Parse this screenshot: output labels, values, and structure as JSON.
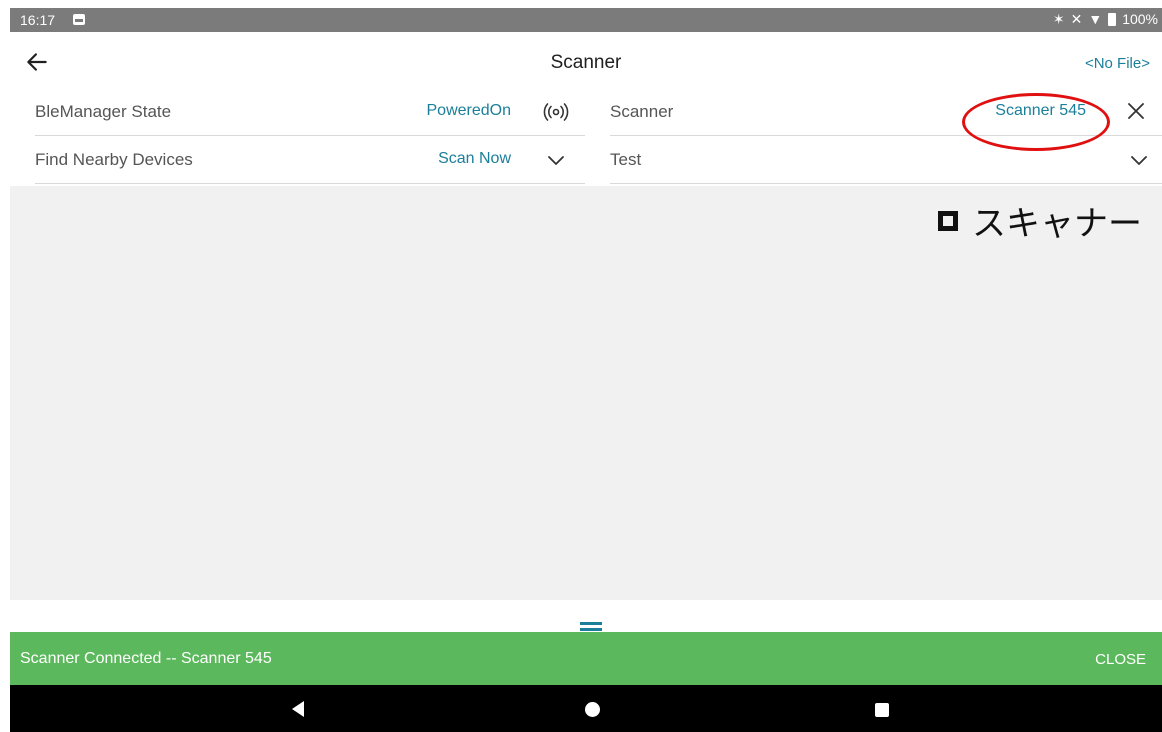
{
  "status_bar": {
    "time": "16:17",
    "battery": "100%",
    "icons": [
      "image-icon",
      "bluetooth-icon",
      "mute-icon",
      "wifi-icon",
      "battery-icon"
    ]
  },
  "app_bar": {
    "title": "Scanner",
    "file_status": "<No File>",
    "back_icon": "arrow-left-icon"
  },
  "left_panel": {
    "rows": [
      {
        "label": "BleManager State",
        "value": "PoweredOn",
        "icon": "broadcast-icon"
      },
      {
        "label": "Find Nearby Devices",
        "value": "Scan Now",
        "icon": "chevron-down-icon"
      }
    ]
  },
  "right_panel": {
    "rows": [
      {
        "label": "Scanner",
        "value": "Scanner 545",
        "icon": "close-icon"
      },
      {
        "label": "Test",
        "value": "",
        "icon": "chevron-down-icon"
      }
    ]
  },
  "annotation": {
    "text": "スキャナー"
  },
  "snackbar": {
    "message": "Scanner Connected -- Scanner 545",
    "action": "CLOSE"
  },
  "colors": {
    "accent": "#1b7f9a",
    "snackbar": "#5cb85c",
    "status_bar": "#7b7b7b",
    "panel_bg": "#f1f1f1",
    "annotation_red": "#e01010"
  }
}
